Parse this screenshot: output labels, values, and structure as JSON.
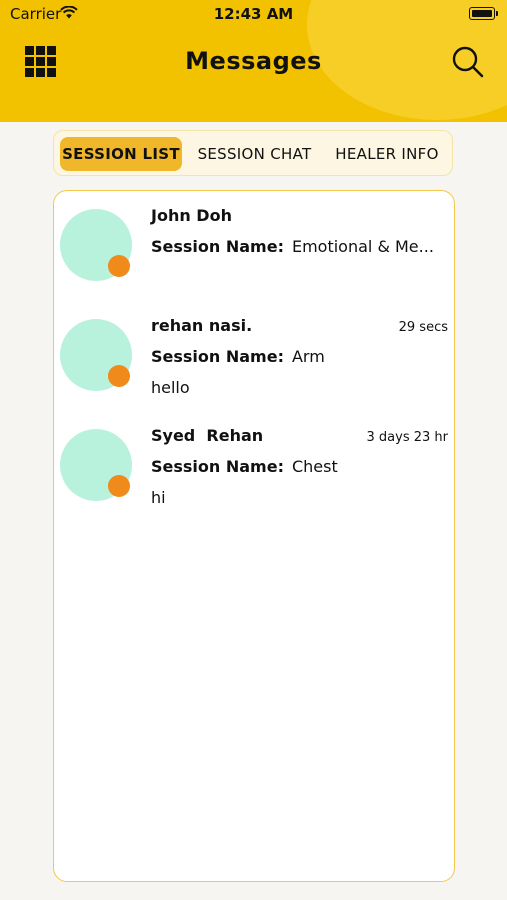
{
  "status_bar": {
    "carrier": "Carrier",
    "time": "12:43 AM"
  },
  "header": {
    "title": "Messages",
    "menu_icon": "grid-icon",
    "search_icon": "search-icon",
    "color": "#f2c200"
  },
  "tabs": [
    {
      "label": "SESSION LIST",
      "active": true
    },
    {
      "label": "SESSION CHAT",
      "active": false
    },
    {
      "label": "HEALER INFO",
      "active": false
    }
  ],
  "sessions": [
    {
      "name": "John Doh",
      "time": "",
      "session_label": "Session Name:",
      "session_name": "Emotional & Me...",
      "message": ""
    },
    {
      "name": "rehan nasi.",
      "time": "29 secs",
      "session_label": "Session Name:",
      "session_name": "Arm",
      "message": "hello"
    },
    {
      "name": "Syed  Rehan",
      "time": "3 days 23 hr",
      "session_label": "Session Name:",
      "session_name": "Chest",
      "message": "hi"
    }
  ],
  "colors": {
    "accent": "#f0b72a",
    "avatar_bg": "#b8f2dc",
    "avatar_dot": "#f08a1a"
  }
}
